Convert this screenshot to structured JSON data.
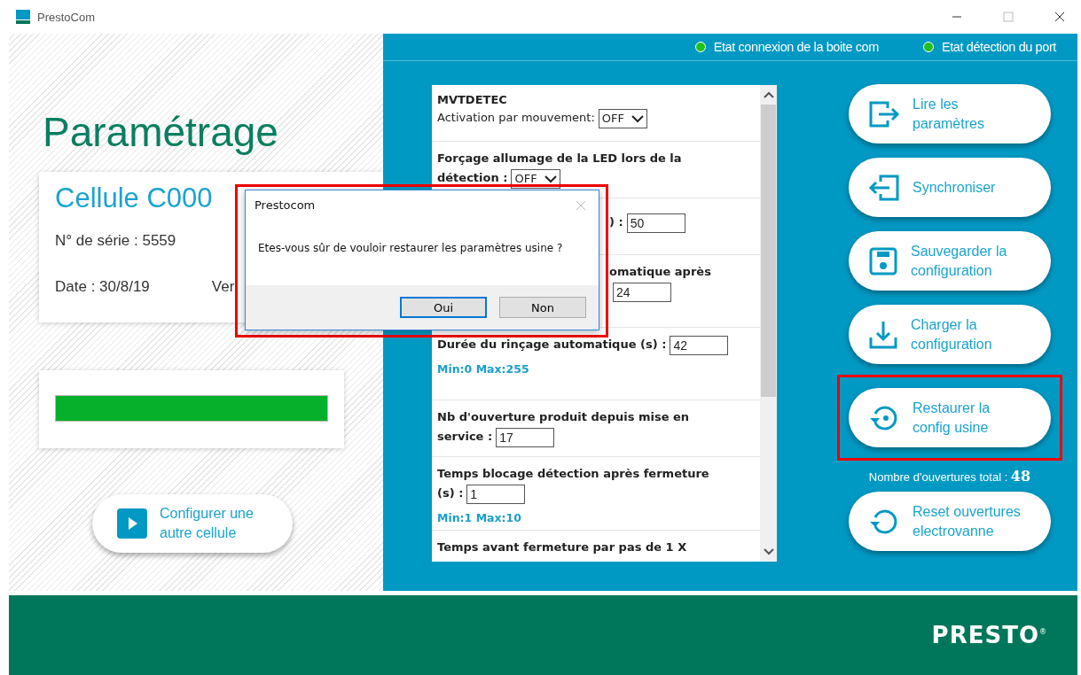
{
  "window": {
    "title": "PrestoCom"
  },
  "left": {
    "heading": "Paramétrage",
    "cell_card": {
      "title": "Cellule C000",
      "serial": "N° de série : 5559",
      "date": "Date : 30/8/19",
      "version": "Ver"
    },
    "progress": {
      "level": 1.0
    },
    "configure_button": "Configurer une autre cellule"
  },
  "status": [
    {
      "label": "Etat connexion de la boite com",
      "on": true
    },
    {
      "label": "Etat détection du port",
      "on": true
    }
  ],
  "params": [
    {
      "kind": "select",
      "title": "MVTDETEC",
      "lines": [
        "Activation par mouvement:"
      ],
      "value": "OFF"
    },
    {
      "kind": "select",
      "lines": [
        "Forçage allumage de la LED lors de la",
        "détection :"
      ],
      "value": "OFF"
    },
    {
      "kind": "covered-input",
      "lines": [
        ") :"
      ],
      "value": "50"
    },
    {
      "kind": "covered-input-below",
      "lines": [
        "omatique après"
      ],
      "value": "24"
    },
    {
      "kind": "input",
      "lines": [
        "Durée du rinçage automatique (s) :"
      ],
      "value": "42",
      "hint": "Min:0 Max:255"
    },
    {
      "kind": "input",
      "lines": [
        "Nb d'ouverture produit depuis mise en",
        "service :"
      ],
      "value": "17"
    },
    {
      "kind": "input",
      "lines": [
        "Temps blocage détection après fermeture",
        "(s) :"
      ],
      "value": "1",
      "hint": "Min:1 Max:10"
    },
    {
      "kind": "label",
      "lines": [
        "Temps avant fermeture par pas de 1 X"
      ]
    }
  ],
  "actions": [
    {
      "kind": "export",
      "label": "Lire les paramètres",
      "highlighted": false
    },
    {
      "kind": "import",
      "label": "Synchroniser",
      "highlighted": false
    },
    {
      "kind": "save",
      "label": "Sauvegarder la configuration",
      "highlighted": false
    },
    {
      "kind": "download",
      "label": "Charger la configuration",
      "highlighted": false
    },
    {
      "kind": "restore",
      "label": "Restaurer la config usine",
      "highlighted": true
    },
    {
      "kind": "reset",
      "label": "Reset ouvertures electrovanne",
      "highlighted": false,
      "caption": "Nombre d'ouvertures total :",
      "count": "48"
    }
  ],
  "dialog": {
    "title": "Prestocom",
    "message": "Etes-vous sûr de vouloir restaurer les paramètres usine ?",
    "buttons": [
      {
        "label": "Oui",
        "selected": true
      },
      {
        "label": "Non",
        "selected": false
      }
    ],
    "highlighted": true
  },
  "footer": {
    "logo": "PRESTO",
    "mark": "®"
  }
}
